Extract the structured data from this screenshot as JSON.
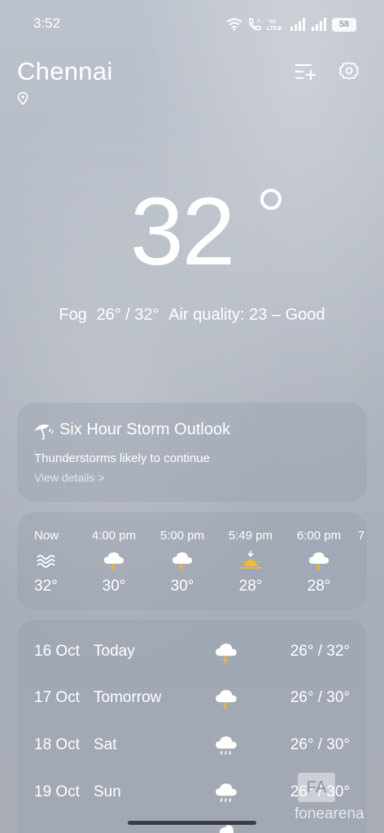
{
  "status_bar": {
    "time": "3:52",
    "battery": "58",
    "icons": [
      "wifi-icon",
      "volte-call-icon",
      "vo-lte-icon",
      "signal-icon",
      "signal-icon",
      "battery-icon"
    ],
    "volte_label": "Vo LTE"
  },
  "header": {
    "city": "Chennai",
    "icons": [
      "location-pin-icon",
      "manage-cities-icon",
      "settings-icon"
    ]
  },
  "current": {
    "temp": "32",
    "condition": "Fog",
    "range": "26° / 32°",
    "air_quality": "Air quality: 23 – Good"
  },
  "storm_card": {
    "title": "Six Hour Storm Outlook",
    "description": "Thunderstorms likely to continue",
    "link": "View details >",
    "icon": "umbrella-storm-icon"
  },
  "hourly": [
    {
      "time": "Now",
      "icon": "fog-icon",
      "temp": "32°"
    },
    {
      "time": "4:00 pm",
      "icon": "thunderstorm-icon",
      "temp": "30°"
    },
    {
      "time": "5:00 pm",
      "icon": "thunderstorm-icon",
      "temp": "30°"
    },
    {
      "time": "5:49 pm",
      "icon": "sunset-icon",
      "temp": "28°"
    },
    {
      "time": "6:00 pm",
      "icon": "thunderstorm-icon",
      "temp": "28°"
    },
    {
      "time": "7",
      "icon": "",
      "temp": ""
    }
  ],
  "daily": [
    {
      "date": "16 Oct",
      "day": "Today",
      "icon": "thunderstorm-icon",
      "temp": "26° / 32°"
    },
    {
      "date": "17 Oct",
      "day": "Tomorrow",
      "icon": "thunderstorm-icon",
      "temp": "26° / 30°"
    },
    {
      "date": "18 Oct",
      "day": "Sat",
      "icon": "rain-icon",
      "temp": "26° / 30°"
    },
    {
      "date": "19 Oct",
      "day": "Sun",
      "icon": "rain-icon",
      "temp": "26° / 30°"
    }
  ],
  "watermark": {
    "letters": "FA",
    "text": "fonearena"
  },
  "colors": {
    "background": "#b4bac4",
    "card": "rgba(150,158,175,0.35)",
    "sun_accent": "#f5b82e",
    "lightning_accent": "#f2b630"
  }
}
